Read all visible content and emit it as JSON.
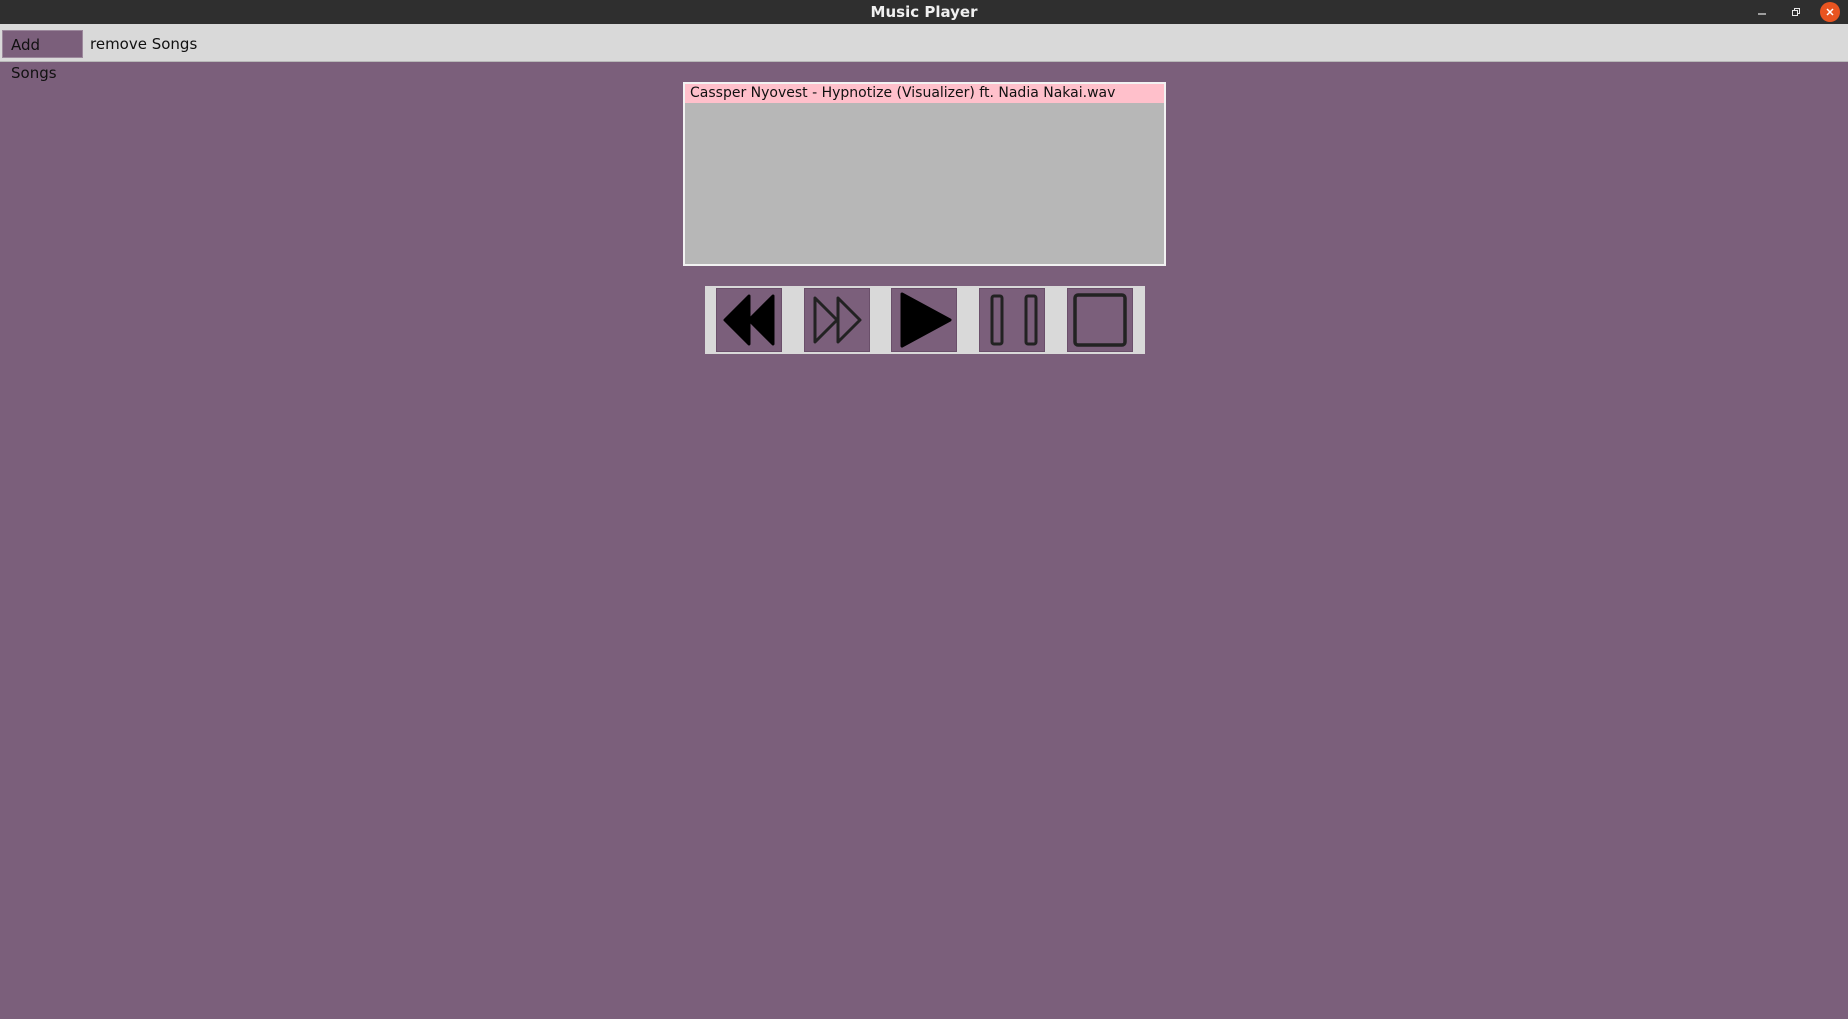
{
  "window": {
    "title": "Music Player",
    "controls": {
      "minimize_icon": "minimize-icon",
      "restore_icon": "restore-icon",
      "close_icon": "close-icon"
    }
  },
  "menubar": {
    "items": [
      {
        "label": "Add Songs",
        "active": true
      },
      {
        "label": "remove Songs",
        "active": false
      }
    ]
  },
  "playlist": {
    "items": [
      {
        "label": "Cassper Nyovest - Hypnotize (Visualizer) ft. Nadia Nakai.wav",
        "selected": true
      }
    ]
  },
  "player_controls": [
    {
      "name": "previous",
      "icon": "rewind-icon"
    },
    {
      "name": "next",
      "icon": "fast-forward-icon"
    },
    {
      "name": "play",
      "icon": "play-icon"
    },
    {
      "name": "pause",
      "icon": "pause-icon"
    },
    {
      "name": "stop",
      "icon": "stop-icon"
    }
  ],
  "colors": {
    "background": "#7b5f7b",
    "menubar": "#d9d9d9",
    "titlebar": "#2f2f2f",
    "playlist_background": "#b7b7b7",
    "selected_row": "#ffc0cb",
    "close_button": "#e95420"
  }
}
